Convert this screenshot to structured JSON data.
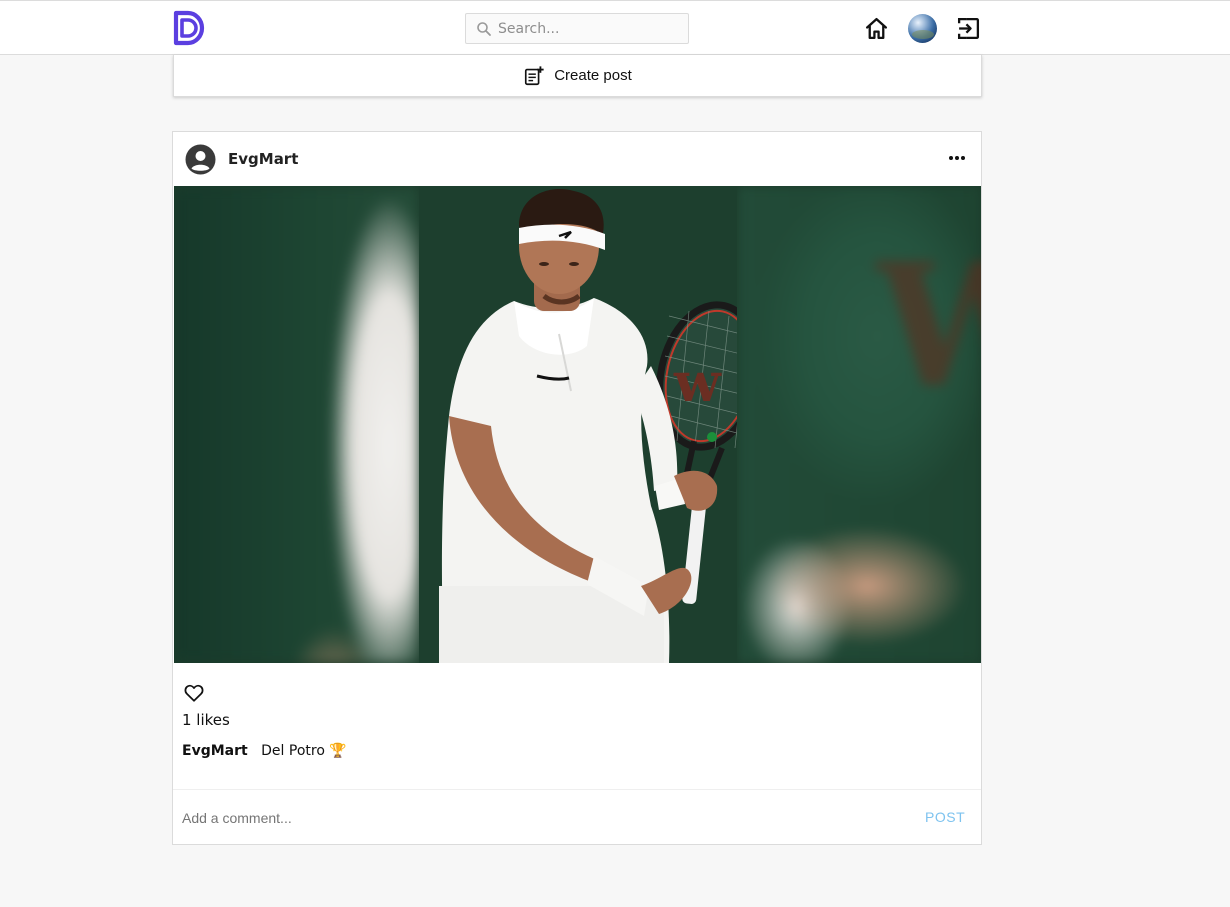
{
  "header": {
    "logo_icon": "d-logo-icon",
    "search": {
      "placeholder": "Search...",
      "value": ""
    },
    "nav": [
      "home-icon",
      "profile-avatar",
      "logout-icon"
    ]
  },
  "create_post": {
    "label": "Create post",
    "icon": "note-add-icon"
  },
  "post": {
    "username": "EvgMart",
    "avatar_icon": "account-circle-icon",
    "more_icon": "more-horizontal-icon",
    "image_alt": "Tennis player in white holding a racket",
    "likes_text": "1 likes",
    "caption": {
      "user": "EvgMart",
      "text": "Del Potro 🏆"
    },
    "comment": {
      "placeholder": "Add a comment...",
      "value": ""
    },
    "post_button": "POST"
  },
  "colors": {
    "brand": "#5b3fe0",
    "post_button": "#7ec3ef",
    "background": "#f7f7f7"
  }
}
